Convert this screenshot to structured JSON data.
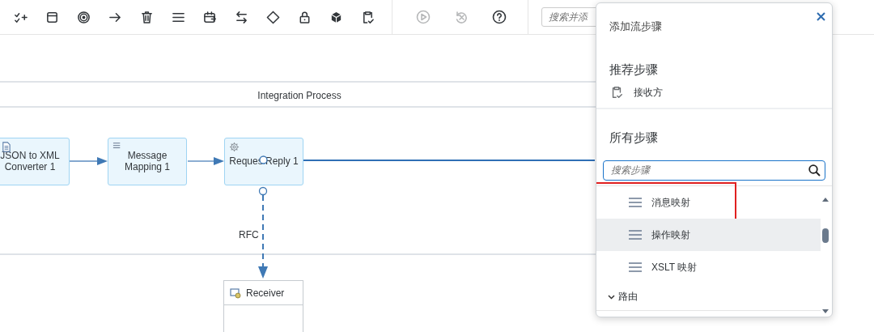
{
  "toolbar": {
    "actions": [
      {
        "disabled": true
      },
      {
        "disabled": true
      },
      {
        "disabled": false
      }
    ],
    "search": {
      "placeholder": "搜索并添"
    }
  },
  "canvas": {
    "pool_title": "Integration Process",
    "nodes": [
      {
        "label": "JSON to XML Converter 1"
      },
      {
        "label": "Message Mapping 1"
      },
      {
        "label": "Reques Reply 1"
      }
    ],
    "connector_label": "RFC",
    "receiver": {
      "label": "Receiver"
    }
  },
  "popover": {
    "title": "添加流步骤",
    "recommended": {
      "heading": "推荐步骤",
      "items": [
        {
          "label": "接收方"
        }
      ]
    },
    "all_steps": {
      "heading": "所有步骤",
      "search": {
        "placeholder": "搜索步骤"
      },
      "items": [
        {
          "label": "消息映射",
          "hovered": false,
          "highlighted": true
        },
        {
          "label": "操作映射",
          "hovered": true,
          "highlighted": false
        },
        {
          "label": "XSLT 映射",
          "hovered": false,
          "highlighted": false
        }
      ],
      "groups": [
        {
          "label": "路由",
          "expanded": true
        }
      ]
    }
  }
}
